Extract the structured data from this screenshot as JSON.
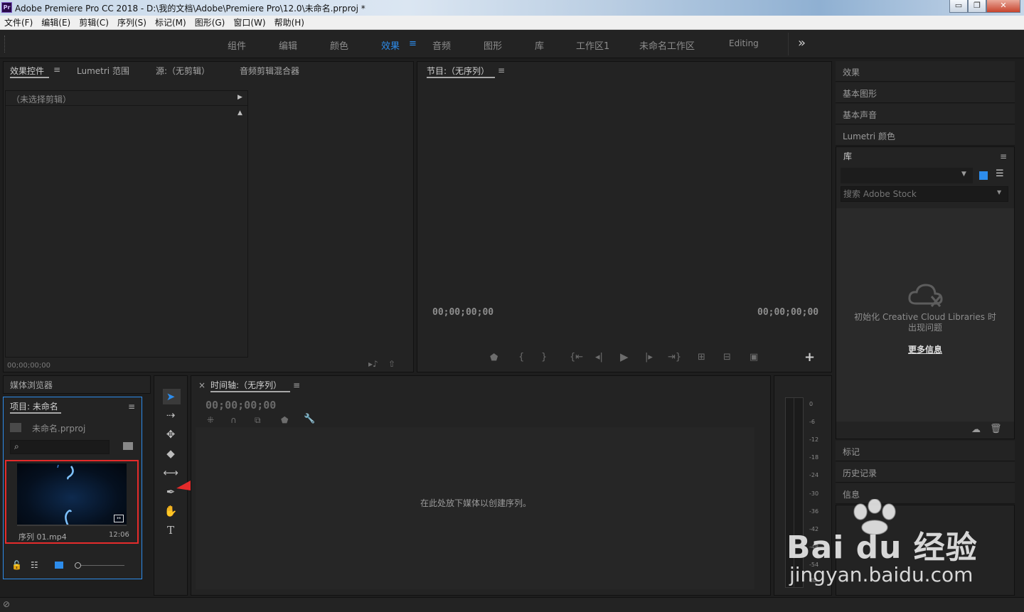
{
  "titlebar": {
    "app_icon": "Pr",
    "title": "Adobe Premiere Pro CC 2018 - D:\\我的文档\\Adobe\\Premiere Pro\\12.0\\未命名.prproj *",
    "minimize": "▭",
    "maximize": "❐",
    "close": "✕"
  },
  "menubar": {
    "items": [
      "文件(F)",
      "编辑(E)",
      "剪辑(C)",
      "序列(S)",
      "标记(M)",
      "图形(G)",
      "窗口(W)",
      "帮助(H)"
    ]
  },
  "workspaces": {
    "tabs": [
      "组件",
      "编辑",
      "颜色",
      "效果",
      "音频",
      "图形",
      "库",
      "工作区1",
      "未命名工作区",
      "Editing"
    ],
    "active": "效果",
    "more": "»",
    "menu_icon": "≡"
  },
  "source_panel": {
    "tabs": [
      "效果控件",
      "Lumetri 范围",
      "源:（无剪辑）",
      "音频剪辑混合器"
    ],
    "menu_icon": "≡",
    "no_clip": "（未选择剪辑）",
    "timecode": "00;00;00;00"
  },
  "program_panel": {
    "title": "节目:（无序列）",
    "menu_icon": "≡",
    "tc_left": "00;00;00;00",
    "tc_right": "00;00;00;00",
    "add": "+"
  },
  "right_panels": {
    "items_top": [
      "效果",
      "基本图形",
      "基本声音",
      "Lumetri 颜色"
    ],
    "library": {
      "title": "库",
      "menu_icon": "≡",
      "search_placeholder": "搜索 Adobe Stock",
      "error_text": "初始化 Creative Cloud Libraries 时出现问题",
      "more_info": "更多信息"
    },
    "items_bottom": [
      "标记",
      "历史记录",
      "信息"
    ]
  },
  "media_browser": {
    "title": "媒体浏览器"
  },
  "project_panel": {
    "title": "项目: 未命名",
    "menu_icon": "≡",
    "file": "未命名.prproj",
    "clip_name": "序列 01.mp4",
    "clip_duration": "12:06"
  },
  "timeline": {
    "close": "×",
    "title": "时间轴:（无序列）",
    "menu_icon": "≡",
    "timecode": "00;00;00;00",
    "drop_hint": "在此处放下媒体以创建序列。"
  },
  "meter": {
    "ticks": [
      "0",
      "-6",
      "-12",
      "-18",
      "-24",
      "-30",
      "-36",
      "-42",
      "-48",
      "-54",
      "dB"
    ]
  },
  "statusbar": {
    "icon": "⊘"
  },
  "watermark": {
    "logo": "Bai du 经验",
    "url": "jingyan.baidu.com"
  },
  "colors": {
    "accent": "#2d8ceb",
    "highlight_box": "#e52b2b",
    "arrow": "#e52b2b",
    "panel_bg": "#232323",
    "frame_bg": "#1e1e1e"
  }
}
